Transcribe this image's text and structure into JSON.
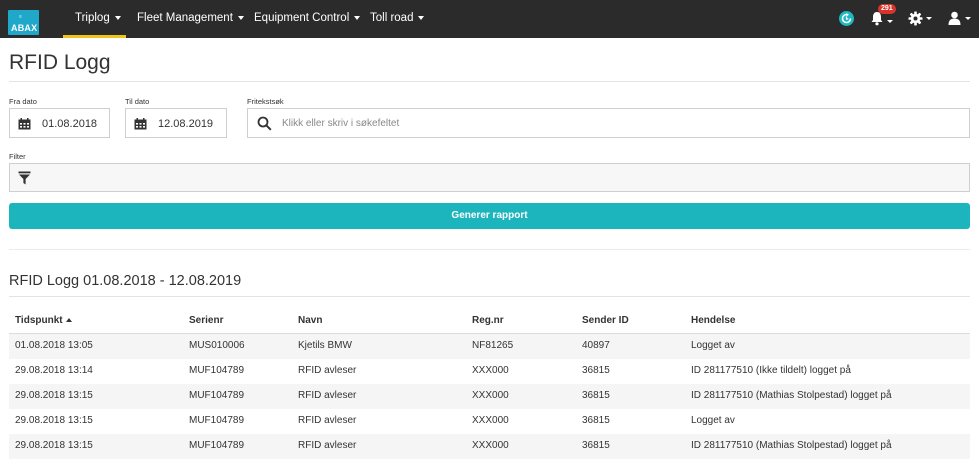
{
  "logo": {
    "small": "≡",
    "text": "ABAX"
  },
  "nav": {
    "items": [
      {
        "label": "Triplog"
      },
      {
        "label": "Fleet Management"
      },
      {
        "label": "Equipment Control"
      },
      {
        "label": "Toll road"
      }
    ],
    "notifications_count": "291"
  },
  "page": {
    "title": "RFID Logg"
  },
  "filters": {
    "from_label": "Fra dato",
    "from_value": "01.08.2018",
    "to_label": "Til dato",
    "to_value": "12.08.2019",
    "search_label": "Fritekstsøk",
    "search_placeholder": "Klikk eller skriv i søkefeltet",
    "filter_label": "Filter"
  },
  "generate_label": "Generer rapport",
  "report": {
    "title": "RFID Logg 01.08.2018 - 12.08.2019",
    "columns": [
      "Tidspunkt",
      "Serienr",
      "Navn",
      "Reg.nr",
      "Sender ID",
      "Hendelse"
    ],
    "rows": [
      [
        "01.08.2018 13:05",
        "MUS010006",
        "Kjetils BMW",
        "NF81265",
        "40897",
        "Logget av"
      ],
      [
        "29.08.2018 13:14",
        "MUF104789",
        "RFID avleser",
        "XXX000",
        "36815",
        "ID 281177510 (Ikke tildelt) logget på"
      ],
      [
        "29.08.2018 13:15",
        "MUF104789",
        "RFID avleser",
        "XXX000",
        "36815",
        "ID 281177510 (Mathias Stolpestad) logget på"
      ],
      [
        "29.08.2018 13:15",
        "MUF104789",
        "RFID avleser",
        "XXX000",
        "36815",
        "Logget av"
      ],
      [
        "29.08.2018 13:15",
        "MUF104789",
        "RFID avleser",
        "XXX000",
        "36815",
        "ID 281177510 (Mathias Stolpestad) logget på"
      ]
    ]
  },
  "colors": {
    "navbar": "#2b2b2b",
    "accent": "#1db5bd",
    "active_tab": "#f0c419",
    "badge": "#d9342b"
  }
}
